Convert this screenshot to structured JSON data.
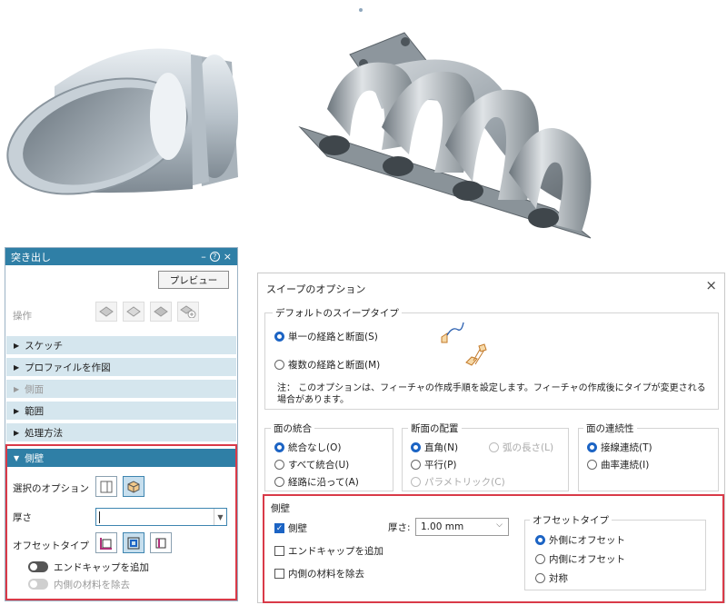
{
  "extrude_panel": {
    "title": "突き出し",
    "controls": {
      "minimize": "–",
      "help": "?",
      "close": "×"
    },
    "preview_label": "プレビュー",
    "operation_label": "操作",
    "sections": {
      "sketch": "スケッチ",
      "create_profile": "プロファイルを作図",
      "side": "側面",
      "range": "範囲",
      "method": "処理方法",
      "side_wall": "側壁"
    },
    "side_wall": {
      "option_label": "選択のオプション",
      "thickness_label": "厚さ",
      "thickness_value": "",
      "offset_type_label": "オフセットタイプ",
      "add_end_cap": "エンドキャップを追加",
      "remove_inner": "内側の材料を除去"
    }
  },
  "sweep_dialog": {
    "title": "スイープのオプション",
    "close": "×",
    "default_sweep_type": {
      "label": "デフォルトのスイープタイプ",
      "options": [
        "単一の経路と断面(S)",
        "複数の経路と断面(M)"
      ],
      "selected": 0
    },
    "note": "注： このオプションは、フィーチャの作成手順を設定します。フィーチャの作成後にタイプが変更される場合があります。",
    "face_merge": {
      "label": "面の統合",
      "options": [
        "統合なし(O)",
        "すべて統合(U)",
        "経路に沿って(A)"
      ],
      "selected": 0
    },
    "section_placement": {
      "label": "断面の配置",
      "options": [
        "直角(N)",
        "平行(P)",
        "パラメトリック(C)",
        "弧の長さ(L)"
      ],
      "selected": 0
    },
    "face_continuity": {
      "label": "面の連続性",
      "options": [
        "接線連続(T)",
        "曲率連続(I)"
      ],
      "selected": 0
    },
    "side_wall": {
      "label": "側壁",
      "side_wall_check": "側壁",
      "thickness_label": "厚さ:",
      "thickness_value": "1.00 mm",
      "add_end_cap": "エンドキャップを追加",
      "remove_inner": "内側の材料を除去",
      "offset_type": {
        "label": "オフセットタイプ",
        "options": [
          "外側にオフセット",
          "内側にオフセット",
          "対称"
        ],
        "selected": 0
      }
    }
  },
  "colors": {
    "accent": "#2f7fa6",
    "section_bg": "#d5e6ee",
    "highlight_border": "#d93a48",
    "radio_selected": "#1c64c4",
    "model_gray": "#9ca7b0"
  }
}
